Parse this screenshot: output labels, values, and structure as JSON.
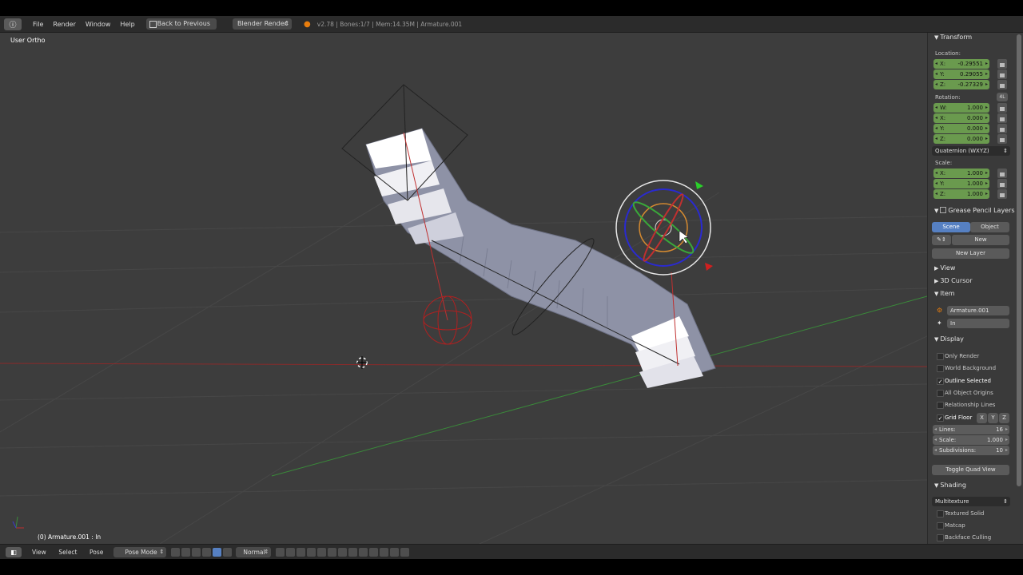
{
  "header": {
    "menu": [
      "File",
      "Render",
      "Window",
      "Help"
    ],
    "back_button": "Back to Previous",
    "render_engine": "Blender Render",
    "stats": "v2.78 | Bones:1/7 | Mem:14.35M | Armature.001"
  },
  "viewport": {
    "view_label": "User Ortho",
    "status": "(0) Armature.001 : In"
  },
  "panel": {
    "transform": {
      "title": "Transform",
      "location_label": "Location:",
      "location": [
        {
          "axis": "X:",
          "value": "-0.29551"
        },
        {
          "axis": "Y:",
          "value": "0.29055"
        },
        {
          "axis": "Z:",
          "value": "-0.27329"
        }
      ],
      "rotation_label": "Rotation:",
      "rotation_badge": "4L",
      "rotation": [
        {
          "axis": "W:",
          "value": "1.000"
        },
        {
          "axis": "X:",
          "value": "0.000"
        },
        {
          "axis": "Y:",
          "value": "0.000"
        },
        {
          "axis": "Z:",
          "value": "0.000"
        }
      ],
      "rotation_mode": "Quaternion (WXYZ)",
      "scale_label": "Scale:",
      "scale": [
        {
          "axis": "X:",
          "value": "1.000"
        },
        {
          "axis": "Y:",
          "value": "1.000"
        },
        {
          "axis": "Z:",
          "value": "1.000"
        }
      ]
    },
    "grease_pencil": {
      "title": "Grease Pencil Layers",
      "tab_scene": "Scene",
      "tab_object": "Object",
      "new_label": "New",
      "new_layer_label": "New Layer"
    },
    "view_title": "View",
    "cursor_title": "3D Cursor",
    "item": {
      "title": "Item",
      "object_name": "Armature.001",
      "bone_name": "In"
    },
    "display": {
      "title": "Display",
      "only_render": "Only Render",
      "world_background": "World Background",
      "outline_selected": "Outline Selected",
      "all_object_origins": "All Object Origins",
      "relationship_lines": "Relationship Lines",
      "grid_floor": "Grid Floor",
      "axis_x": "X",
      "axis_y": "Y",
      "axis_z": "Z",
      "lines_label": "Lines:",
      "lines_value": "16",
      "scale_label": "Scale:",
      "scale_value": "1.000",
      "subdiv_label": "Subdivisions:",
      "subdiv_value": "10",
      "toggle_quad": "Toggle Quad View"
    },
    "shading": {
      "title": "Shading",
      "mode": "Multitexture",
      "textured_solid": "Textured Solid",
      "matcap": "Matcap",
      "backface_culling": "Backface Culling"
    }
  },
  "toolbar": {
    "menu": [
      "View",
      "Select",
      "Pose"
    ],
    "mode": "Pose Mode",
    "orientation": "Normal"
  },
  "colors": {
    "viewport_bg": "#3d3d3d",
    "field_green": "#6a9a4e",
    "accent_blue": "#5680c2",
    "x_axis": "#b02020",
    "y_axis": "#3a8a3a"
  }
}
